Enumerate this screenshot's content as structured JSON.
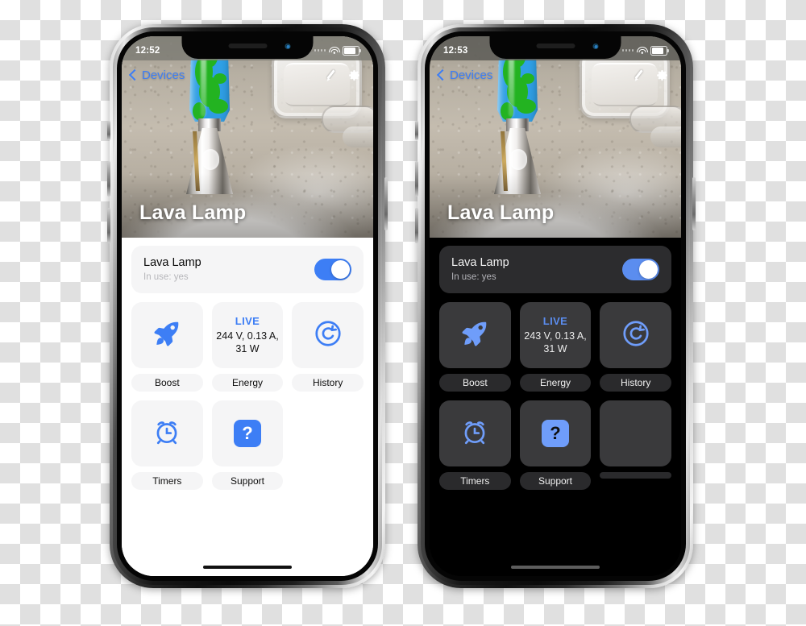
{
  "phones": [
    {
      "id": "light",
      "theme": "light",
      "statusbar": {
        "time": "12:52",
        "wifi_icon": "wifi-icon",
        "battery_icon": "battery-icon",
        "signal_icon": "signal-dots-icon"
      },
      "navbar": {
        "back_label": "Devices",
        "back_icon": "chevron-left-icon",
        "edit_icon": "pencil-icon",
        "settings_icon": "gear-icon"
      },
      "hero": {
        "title": "Lava Lamp"
      },
      "device_card": {
        "name": "Lava Lamp",
        "status": "In use: yes",
        "toggle_on": true
      },
      "tiles": [
        {
          "label": "Boost",
          "icon": "rocket-icon"
        },
        {
          "label": "Energy",
          "icon": "live-readout",
          "live_label": "LIVE",
          "value": "244 V, 0.13 A, 31 W"
        },
        {
          "label": "History",
          "icon": "history-undo-icon"
        },
        {
          "label": "Timers",
          "icon": "alarm-clock-icon"
        },
        {
          "label": "Support",
          "icon": "question-mark-icon"
        }
      ]
    },
    {
      "id": "dark",
      "theme": "dark",
      "statusbar": {
        "time": "12:53",
        "wifi_icon": "wifi-icon",
        "battery_icon": "battery-icon",
        "signal_icon": "signal-dots-icon"
      },
      "navbar": {
        "back_label": "Devices",
        "back_icon": "chevron-left-icon",
        "edit_icon": "pencil-icon",
        "settings_icon": "gear-icon"
      },
      "hero": {
        "title": "Lava Lamp"
      },
      "device_card": {
        "name": "Lava Lamp",
        "status": "In use: yes",
        "toggle_on": true
      },
      "tiles": [
        {
          "label": "Boost",
          "icon": "rocket-icon"
        },
        {
          "label": "Energy",
          "icon": "live-readout",
          "live_label": "LIVE",
          "value": "243 V, 0.13 A, 31 W"
        },
        {
          "label": "History",
          "icon": "history-undo-icon"
        },
        {
          "label": "Timers",
          "icon": "alarm-clock-icon"
        },
        {
          "label": "Support",
          "icon": "question-mark-icon"
        }
      ]
    }
  ],
  "colors": {
    "accent_light": "#3d7ef5",
    "accent_dark": "#6f9dfa",
    "card_light": "#f5f5f6",
    "card_dark": "#2c2c2e",
    "tile_dark": "#3a3a3c"
  }
}
